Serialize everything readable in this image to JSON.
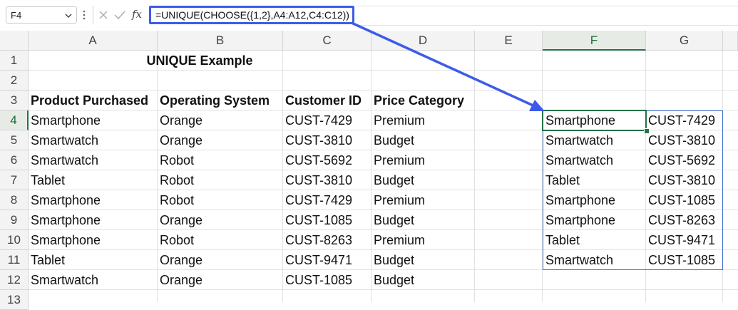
{
  "formula_bar": {
    "name_box": "F4",
    "fx_label": "fx",
    "formula": "=UNIQUE(CHOOSE({1,2},A4:A12,C4:C12))"
  },
  "columns": [
    "A",
    "B",
    "C",
    "D",
    "E",
    "F",
    "G"
  ],
  "rows": [
    "1",
    "2",
    "3",
    "4",
    "5",
    "6",
    "7",
    "8",
    "9",
    "10",
    "11",
    "12",
    "13"
  ],
  "sheet": {
    "title": "UNIQUE Example",
    "headers": [
      "Product Purchased",
      "Operating System",
      "Customer ID",
      "Price Category"
    ],
    "data": [
      [
        "Smartphone",
        "Orange",
        "CUST-7429",
        "Premium"
      ],
      [
        "Smartwatch",
        "Orange",
        "CUST-3810",
        "Budget"
      ],
      [
        "Smartwatch",
        "Robot",
        "CUST-5692",
        "Premium"
      ],
      [
        "Tablet",
        "Robot",
        "CUST-3810",
        "Budget"
      ],
      [
        "Smartphone",
        "Robot",
        "CUST-7429",
        "Premium"
      ],
      [
        "Smartphone",
        "Orange",
        "CUST-1085",
        "Budget"
      ],
      [
        "Smartphone",
        "Robot",
        "CUST-8263",
        "Premium"
      ],
      [
        "Tablet",
        "Orange",
        "CUST-9471",
        "Budget"
      ],
      [
        "Smartwatch",
        "Orange",
        "CUST-1085",
        "Budget"
      ]
    ],
    "result": [
      [
        "Smartphone",
        "CUST-7429"
      ],
      [
        "Smartwatch",
        "CUST-3810"
      ],
      [
        "Smartwatch",
        "CUST-5692"
      ],
      [
        "Tablet",
        "CUST-3810"
      ],
      [
        "Smartphone",
        "CUST-1085"
      ],
      [
        "Smartphone",
        "CUST-8263"
      ],
      [
        "Tablet",
        "CUST-9471"
      ],
      [
        "Smartwatch",
        "CUST-1085"
      ]
    ]
  },
  "colors": {
    "accent_green": "#217346",
    "arrow_blue": "#3d5bea",
    "spill_border": "#3b6fcf"
  }
}
